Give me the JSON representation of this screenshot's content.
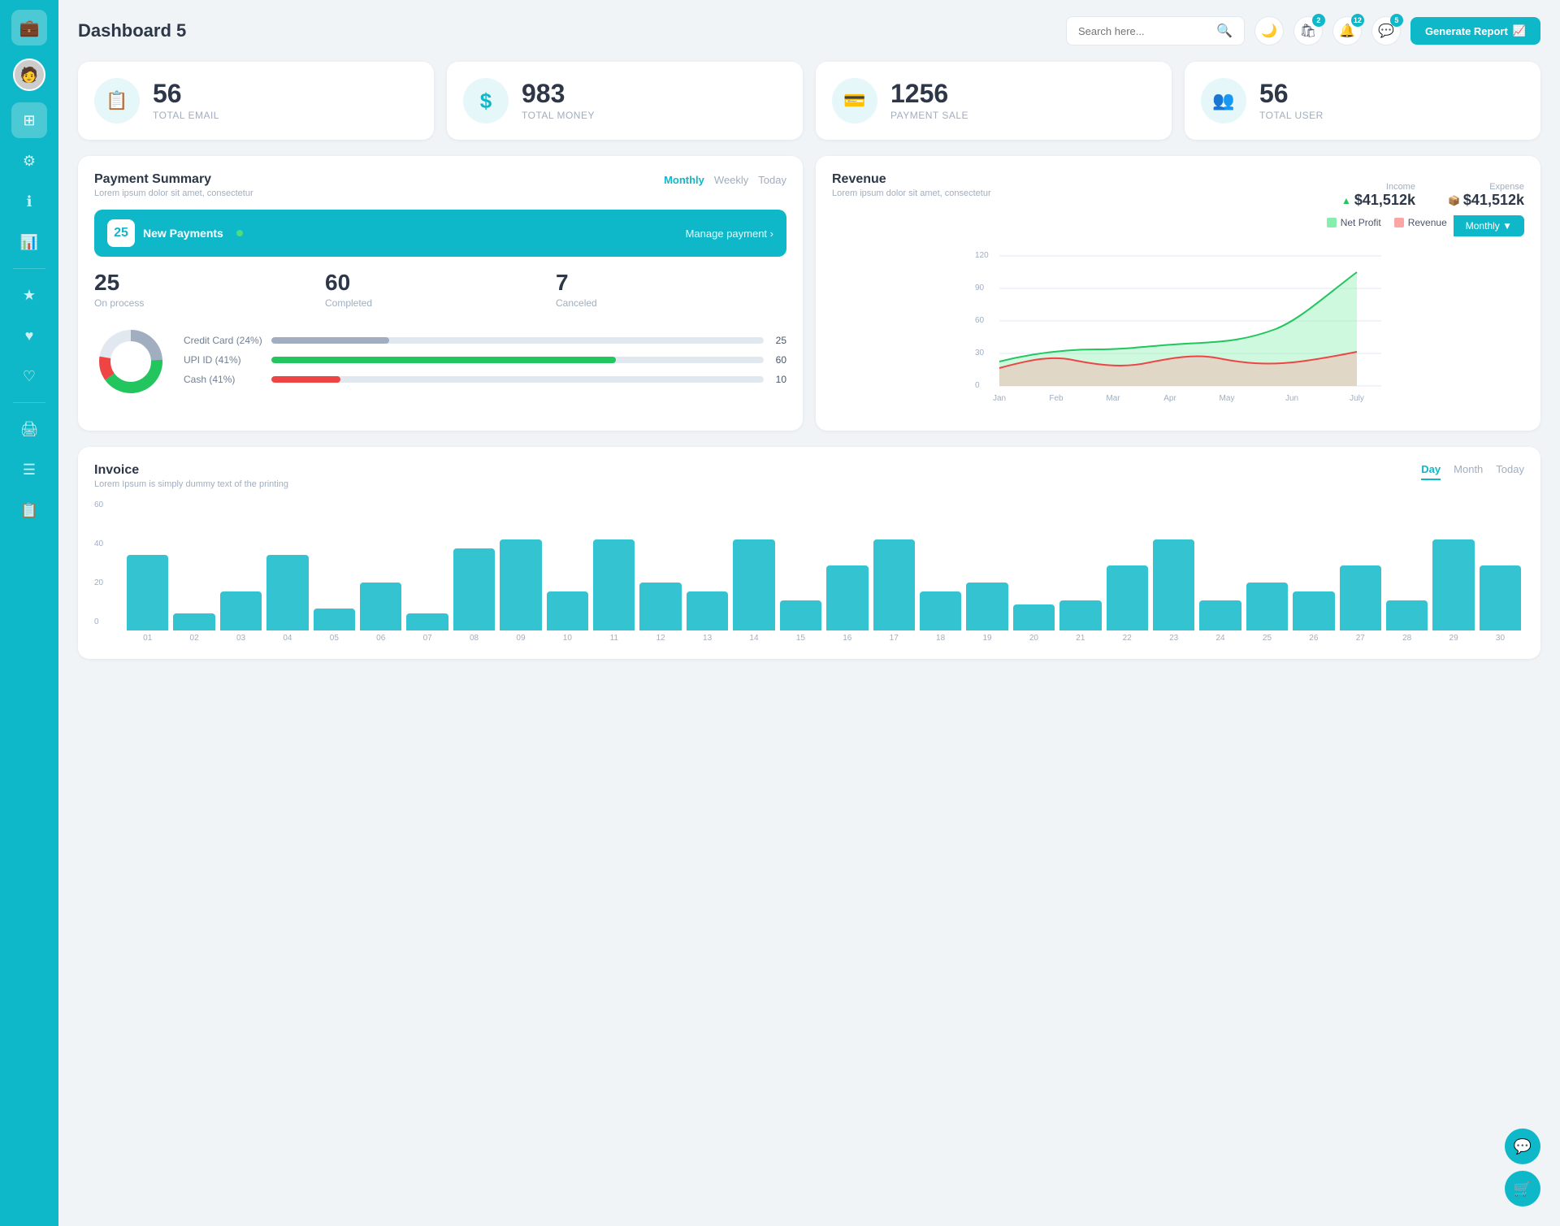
{
  "sidebar": {
    "logo_icon": "💼",
    "items": [
      {
        "id": "avatar",
        "icon": "👤",
        "active": false
      },
      {
        "id": "dashboard",
        "icon": "⊞",
        "active": true
      },
      {
        "id": "settings",
        "icon": "⚙",
        "active": false
      },
      {
        "id": "info",
        "icon": "ℹ",
        "active": false
      },
      {
        "id": "analytics",
        "icon": "📊",
        "active": false
      },
      {
        "id": "star",
        "icon": "★",
        "active": false
      },
      {
        "id": "heart",
        "icon": "♥",
        "active": false
      },
      {
        "id": "heart2",
        "icon": "♡",
        "active": false
      },
      {
        "id": "print",
        "icon": "🖨",
        "active": false
      },
      {
        "id": "menu",
        "icon": "☰",
        "active": false
      },
      {
        "id": "list",
        "icon": "📋",
        "active": false
      }
    ]
  },
  "header": {
    "title": "Dashboard 5",
    "search_placeholder": "Search here...",
    "generate_btn": "Generate Report",
    "notifications": [
      {
        "icon": "🛍",
        "count": "2"
      },
      {
        "icon": "🔔",
        "count": "12"
      },
      {
        "icon": "💬",
        "count": "5"
      }
    ]
  },
  "stats": [
    {
      "id": "total-email",
      "num": "56",
      "label": "TOTAL EMAIL",
      "icon": "📋"
    },
    {
      "id": "total-money",
      "num": "983",
      "label": "TOTAL MONEY",
      "icon": "$"
    },
    {
      "id": "payment-sale",
      "num": "1256",
      "label": "PAYMENT SALE",
      "icon": "💳"
    },
    {
      "id": "total-user",
      "num": "56",
      "label": "TOTAL USER",
      "icon": "👥"
    }
  ],
  "payment_summary": {
    "title": "Payment Summary",
    "subtitle": "Lorem ipsum dolor sit amet, consectetur",
    "tabs": [
      "Monthly",
      "Weekly",
      "Today"
    ],
    "active_tab": "Monthly",
    "new_payments": {
      "count": "25",
      "label": "New Payments",
      "manage_link": "Manage payment ›"
    },
    "process_stats": [
      {
        "num": "25",
        "label": "On process"
      },
      {
        "num": "60",
        "label": "Completed"
      },
      {
        "num": "7",
        "label": "Canceled"
      }
    ],
    "payment_methods": [
      {
        "label": "Credit Card (24%)",
        "pct": 24,
        "color": "#a0aec0",
        "val": "25"
      },
      {
        "label": "UPI ID (41%)",
        "pct": 41,
        "color": "#22c55e",
        "val": "60"
      },
      {
        "label": "Cash (41%)",
        "pct": 41,
        "color": "#ef4444",
        "val": "10"
      }
    ]
  },
  "revenue": {
    "title": "Revenue",
    "subtitle": "Lorem ipsum dolor sit amet, consectetur",
    "tabs": [
      "Monthly",
      "▼"
    ],
    "active_tab": "Monthly",
    "income": {
      "label": "Income",
      "icon": "▲",
      "value": "$41,512k",
      "color": "#22c55e"
    },
    "expense": {
      "label": "Expense",
      "icon": "📦",
      "value": "$41,512k",
      "color": "#f97316"
    },
    "legend": [
      {
        "label": "Net Profit",
        "color": "#86efac"
      },
      {
        "label": "Revenue",
        "color": "#fca5a5"
      }
    ],
    "x_labels": [
      "Jan",
      "Feb",
      "Mar",
      "Apr",
      "May",
      "Jun",
      "July"
    ],
    "y_labels": [
      "120",
      "90",
      "60",
      "30",
      "0"
    ]
  },
  "invoice": {
    "title": "Invoice",
    "subtitle": "Lorem Ipsum is simply dummy text of the printing",
    "tabs": [
      "Day",
      "Month",
      "Today"
    ],
    "active_tab": "Day",
    "y_labels": [
      "60",
      "40",
      "20",
      "0"
    ],
    "x_labels": [
      "01",
      "02",
      "03",
      "04",
      "05",
      "06",
      "07",
      "08",
      "09",
      "10",
      "11",
      "12",
      "13",
      "14",
      "15",
      "16",
      "17",
      "18",
      "19",
      "20",
      "21",
      "22",
      "23",
      "24",
      "25",
      "26",
      "27",
      "28",
      "29",
      "30"
    ],
    "bars": [
      35,
      8,
      18,
      35,
      10,
      22,
      8,
      38,
      42,
      18,
      42,
      22,
      18,
      42,
      14,
      30,
      42,
      18,
      22,
      12,
      14,
      30,
      42,
      14,
      22,
      18,
      30,
      14,
      42,
      30
    ]
  },
  "floats": {
    "chat_icon": "💬",
    "cart_icon": "🛒"
  }
}
